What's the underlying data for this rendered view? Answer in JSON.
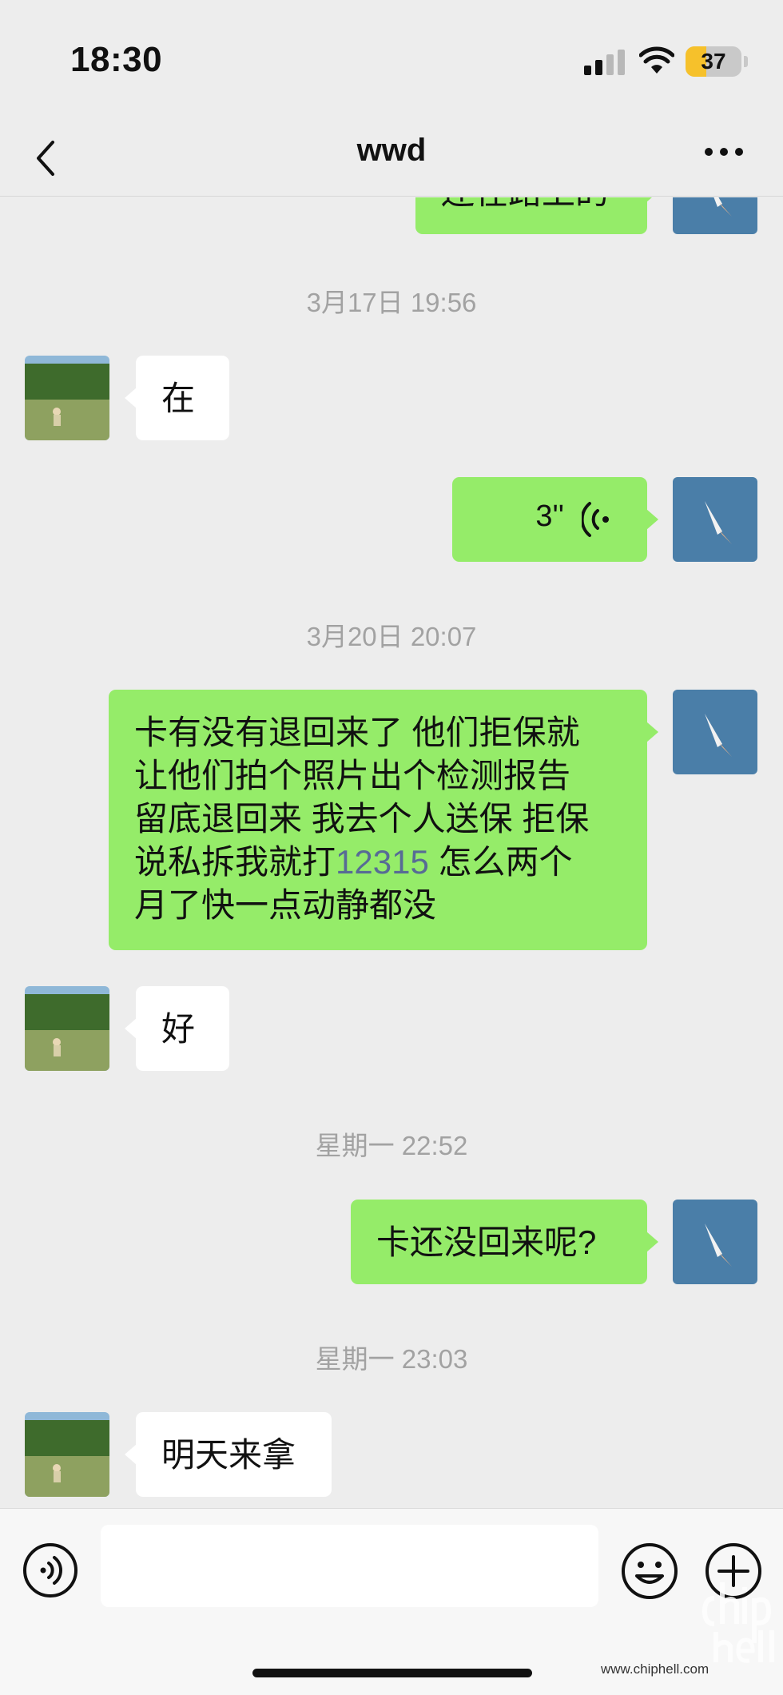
{
  "status_bar": {
    "time": "18:30",
    "battery_level": "37",
    "battery_fraction": 0.37,
    "cellular_bars_active": 2
  },
  "nav": {
    "title": "wwd",
    "back_icon": "chevron-left-icon",
    "more_icon": "more-dots-icon"
  },
  "messages": {
    "partial_top": {
      "direction": "outgoing",
      "text": "还在路上的"
    },
    "ts1": "3月17日 19:56",
    "m1": {
      "direction": "incoming",
      "text": "在"
    },
    "m2": {
      "direction": "outgoing",
      "type": "voice",
      "duration": "3''",
      "icon": "voice-wave-icon"
    },
    "ts2": "3月20日 20:07",
    "m3": {
      "direction": "outgoing",
      "line1": "卡有没有退回来了 他们拒保就",
      "line2": "让他们拍个照片出个检测报告",
      "line3": "留底退回来 我去个人送保 拒保",
      "line4_prefix": "说私拆我就打",
      "line4_link": "12315",
      "line4_suffix": " 怎么两个",
      "line5": "月了快一点动静都没"
    },
    "m4": {
      "direction": "incoming",
      "text": "好"
    },
    "ts3": "星期一 22:52",
    "m5": {
      "direction": "outgoing",
      "text": "卡还没回来呢?"
    },
    "ts4": "星期一 23:03",
    "m6": {
      "direction": "incoming",
      "text": "明天来拿"
    }
  },
  "input_bar": {
    "text_value": "",
    "voice_icon": "voice-input-icon",
    "emoji_icon": "emoji-icon",
    "plus_icon": "plus-circle-icon"
  },
  "watermark": {
    "logo": "chiphell-logo",
    "url": "www.chiphell.com"
  },
  "colors": {
    "background": "#ededed",
    "outgoing_bubble": "#95ec69",
    "incoming_bubble": "#ffffff",
    "timestamp": "#a2a2a2",
    "link": "#576b95",
    "battery": "#f6c12b"
  }
}
